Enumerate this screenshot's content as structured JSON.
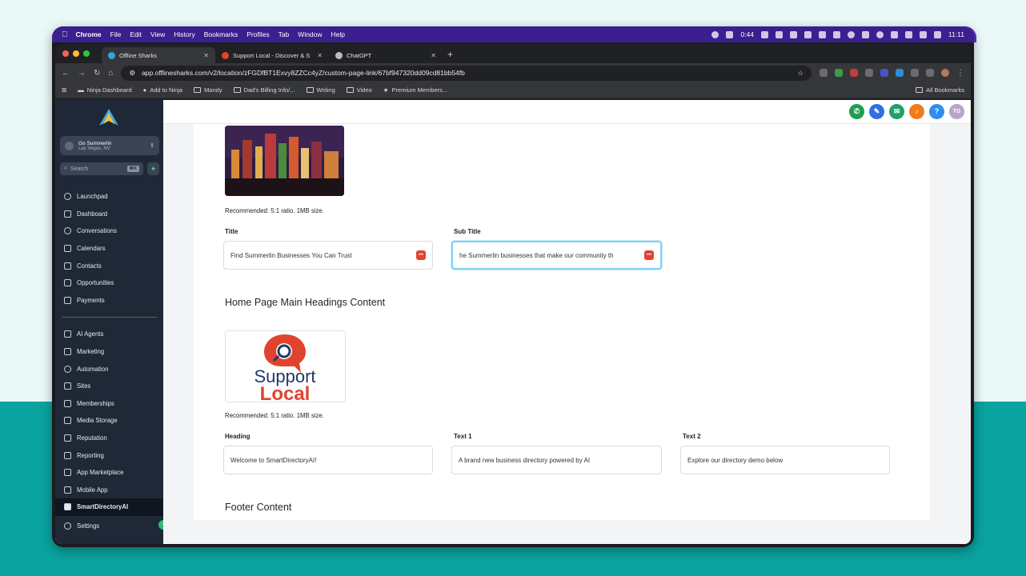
{
  "menubar": {
    "app": "Chrome",
    "items": [
      "File",
      "Edit",
      "View",
      "History",
      "Bookmarks",
      "Profiles",
      "Tab",
      "Window",
      "Help"
    ],
    "battery_time": "0:44",
    "clock": "11:11"
  },
  "tabs": [
    {
      "title": "Offline Sharks",
      "active": true
    },
    {
      "title": "Support Local - Discover & S",
      "active": false
    },
    {
      "title": "ChatGPT",
      "active": false
    }
  ],
  "omnibox": {
    "url": "app.offlinesharks.com/v2/location/zFGDfBT1Exvy8ZZCc4yZ/custom-page-link/67bf947320dd09cd81bb54fb"
  },
  "bookmarks": {
    "items": [
      "Ninja Dashboard",
      "Add to Ninja",
      "Mandy",
      "Dad's Billing Info/...",
      "Writing",
      "Video",
      "Premium Members..."
    ],
    "all": "All Bookmarks"
  },
  "sidebar": {
    "location_name": "Go Summerlin",
    "location_sub": "Las Vegas, NV",
    "search_placeholder": "Search",
    "search_kbd": "⌘K",
    "nav_top": [
      "Launchpad",
      "Dashboard",
      "Conversations",
      "Calendars",
      "Contacts",
      "Opportunities",
      "Payments"
    ],
    "nav_bottom": [
      "AI Agents",
      "Marketing",
      "Automation",
      "Sites",
      "Memberships",
      "Media Storage",
      "Reputation",
      "Reporting",
      "App Marketplace",
      "Mobile App",
      "SmartDirectoryAI"
    ],
    "active_item": "SmartDirectoryAI",
    "settings": "Settings"
  },
  "topbar": {
    "avatar_initials": "TG"
  },
  "content": {
    "recommended_1": "Recommended: 5:1 ratio. 1MB size.",
    "title_label": "Title",
    "title_value": "Find Summerlin Businesses You Can Trust",
    "subtitle_label": "Sub Title",
    "subtitle_value": "he Summerlin businesses that make our community th",
    "home_heading": "Home Page Main Headings Content",
    "logo_text_1": "Support",
    "logo_text_2": "Local",
    "recommended_2": "Recommended: 5:1 ratio. 1MB size.",
    "heading_label": "Heading",
    "heading_value": "Welcome to SmartDirectoryAI!",
    "text1_label": "Text 1",
    "text1_value": "A brand new business directory powered by AI",
    "text2_label": "Text 2",
    "text2_value": "Explore our directory demo below",
    "footer_heading": "Footer Content",
    "field_badge": "•••"
  },
  "colors": {
    "sidebar": "#1e2836",
    "accent_red": "#e0442f",
    "focus": "#7fd0f2",
    "teal_bg": "#0aa39f"
  }
}
